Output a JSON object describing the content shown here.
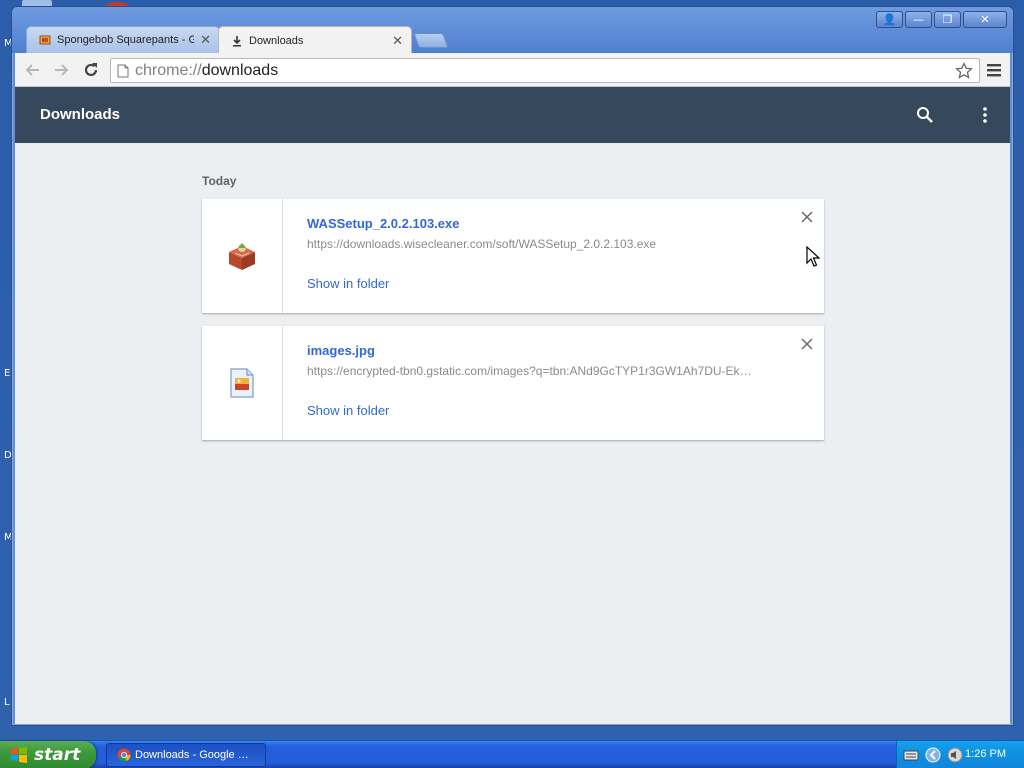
{
  "window": {
    "controls": [
      "👤",
      "—",
      "❐",
      "✕"
    ]
  },
  "tabs": [
    {
      "title": "Spongebob Squarepants - G",
      "active": false
    },
    {
      "title": "Downloads",
      "active": true
    }
  ],
  "toolbar": {
    "url_scheme": "chrome://",
    "url_host": "downloads"
  },
  "page": {
    "app_title": "Downloads",
    "section_label": "Today",
    "downloads": [
      {
        "name": "WASSetup_2.0.2.103.exe",
        "url": "https://downloads.wisecleaner.com/soft/WASSetup_2.0.2.103.exe",
        "action": "Show in folder",
        "icon": "package-icon"
      },
      {
        "name": "images.jpg",
        "url": "https://encrypted-tbn0.gstatic.com/images?q=tbn:ANd9GcTYP1r3GW1Ah7DU-Ek…",
        "action": "Show in folder",
        "icon": "image-file-icon"
      }
    ]
  },
  "taskbar": {
    "start_label": "start",
    "task_label": "Downloads - Google …",
    "clock": "1:26 PM"
  },
  "desktop": {
    "letters": [
      "M",
      "E",
      "D",
      "M",
      "L"
    ]
  },
  "colors": {
    "appbar": "#36495c",
    "link": "#3367d6",
    "page_bg": "#eceff1"
  }
}
